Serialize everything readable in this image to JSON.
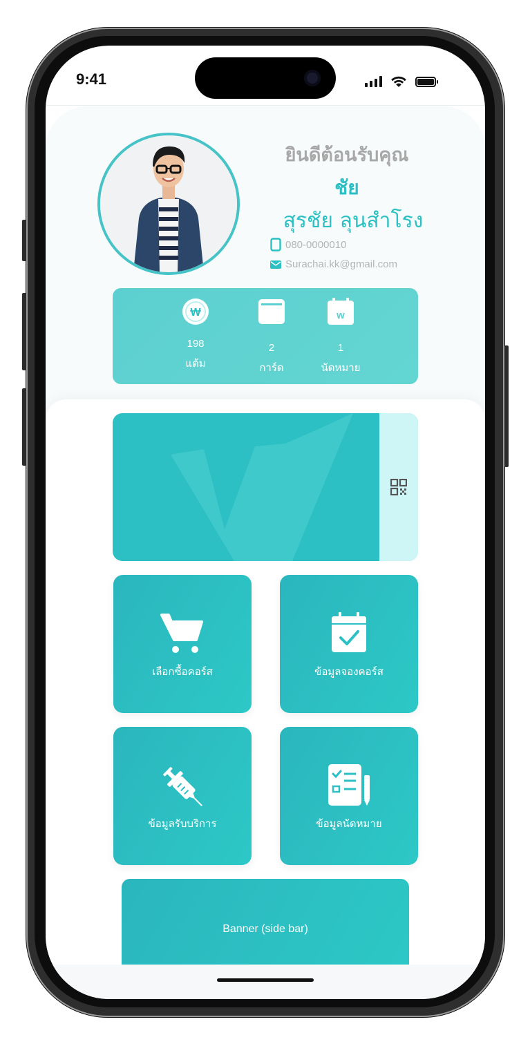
{
  "status_bar": {
    "time": "9:41"
  },
  "profile": {
    "greeting": "ยินดีต้อนรับคุณ",
    "nickname": "ชัย",
    "full_name": "สุรชัย ลุนสำโรง",
    "phone": "080-0000010",
    "email": "Surachai.kk@gmail.com"
  },
  "stats": [
    {
      "icon": "coin-w-icon",
      "value": "198",
      "label": "แต้ม"
    },
    {
      "icon": "card-icon",
      "value": "2",
      "label": "การ์ด"
    },
    {
      "icon": "calendar-w-icon",
      "value": "1",
      "label": "นัดหมาย"
    }
  ],
  "member_card": {
    "qr_icon": "qr-code-icon"
  },
  "menu": [
    {
      "icon": "shopping-cart-icon",
      "label": "เลือกซื้อคอร์ส"
    },
    {
      "icon": "calendar-check-icon",
      "label": "ข้อมูลจองคอร์ส"
    },
    {
      "icon": "syringe-icon",
      "label": "ข้อมูลรับบริการ"
    },
    {
      "icon": "checklist-icon",
      "label": "ข้อมูลนัดหมาย"
    }
  ],
  "banner": {
    "label": "Banner (side bar)"
  },
  "colors": {
    "accent": "#2cc0c4",
    "stats_card": "#5ccfd0",
    "qr_strip": "#cef6f6",
    "greeting_grey": "#a8a8a8"
  }
}
